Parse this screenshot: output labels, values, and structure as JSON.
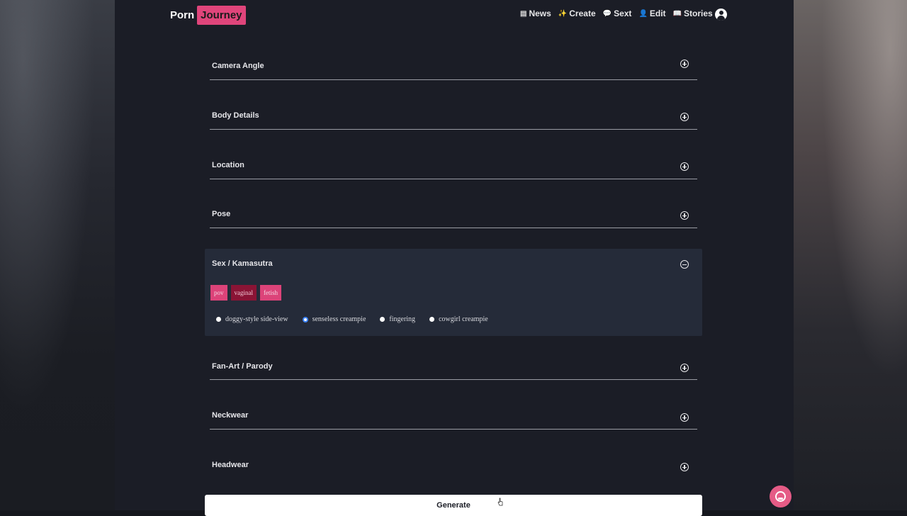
{
  "header": {
    "logo_part1": "Porn",
    "logo_part2": "Journey",
    "nav": [
      {
        "icon": "news-icon",
        "label": "News"
      },
      {
        "icon": "sparkle-icon",
        "label": "Create"
      },
      {
        "icon": "chat-bubble-icon",
        "label": "Sext"
      },
      {
        "icon": "person-icon",
        "label": "Edit"
      },
      {
        "icon": "book-icon",
        "label": "Stories"
      }
    ],
    "user_icon": "user-circle-icon"
  },
  "sections": [
    {
      "title": "Camera Angle",
      "state": "collapsed"
    },
    {
      "title": "Body Details",
      "state": "collapsed"
    },
    {
      "title": "Location",
      "state": "collapsed"
    },
    {
      "title": "Pose",
      "state": "collapsed"
    },
    {
      "title": "Sex / Kamasutra",
      "state": "expanded"
    },
    {
      "title": "Fan-Art / Parody",
      "state": "collapsed"
    },
    {
      "title": "Neckwear",
      "state": "collapsed"
    },
    {
      "title": "Headwear",
      "state": "collapsed"
    }
  ],
  "expanded_section": {
    "tags": [
      {
        "label": "pov",
        "active": true
      },
      {
        "label": "vaginal",
        "active": false
      },
      {
        "label": "fetish",
        "active": true
      }
    ],
    "options": [
      {
        "label": "doggy-style side-view",
        "selected": false
      },
      {
        "label": "senseless creampie",
        "selected": true
      },
      {
        "label": "fingering",
        "selected": false
      },
      {
        "label": "cowgirl creampie",
        "selected": false
      }
    ]
  },
  "generate_button": "Generate",
  "support_icon": "headset-icon",
  "colors": {
    "accent": "#e0457b",
    "accent_dark": "#8a1435",
    "page_bg": "#1b1d26",
    "expanded_bg": "#252b39",
    "radio_selected": "#3b82f6"
  }
}
